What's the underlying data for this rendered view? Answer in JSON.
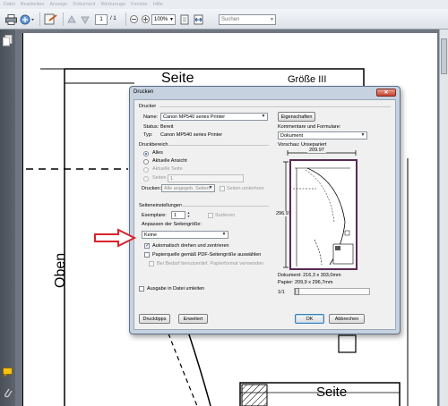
{
  "menubar": [
    "Datei",
    "Bearbeiten",
    "Anzeige",
    "Dokument",
    "Werkzeuge",
    "Fenster",
    "Hilfe"
  ],
  "toolbar": {
    "page_current": "1",
    "page_total": "/ 1",
    "zoom": "100%",
    "search_placeholder": "Suchen"
  },
  "document": {
    "label_seite_top": "Seite",
    "label_groesse": "Größe III",
    "label_oben": "Oben",
    "label_seite_bottom": "Seite"
  },
  "dialog": {
    "title": "Drucken",
    "printer_section": "Drucker",
    "name_label": "Name:",
    "printer_name": "Canon MP540 series Printer",
    "properties_button": "Eigenschaften",
    "status_label": "Status:",
    "status_value": "Bereit",
    "type_label": "Typ:",
    "type_value": "Canon MP540 series Printer",
    "comments_label": "Kommentare und Formulare:",
    "comments_value": "Dokument",
    "range_section": "Druckbereich",
    "range_all": "Alles",
    "range_current_view": "Aktuelle Ansicht",
    "range_current_page": "Aktuelle Seite",
    "range_pages": "Seiten",
    "range_pages_value": "1",
    "print_label": "Drucken:",
    "print_value": "Alle angegeb. Seiten",
    "reverse_pages": "Seiten umkehren",
    "settings_section": "Seiteneinstellungen",
    "copies_label": "Exemplare:",
    "copies_value": "1",
    "collate_label": "Sortieren",
    "scaling_label": "Anpassen der Seitengröße:",
    "scaling_value": "Keine",
    "auto_rotate_label": "Automatisch drehen und zentrieren",
    "paper_source_label": "Papierquelle gemäß PDF-Seitengröße auswählen",
    "custom_paper_label": "Bei Bedarf benutzerdef. Papierformat verwenden",
    "print_to_file_label": "Ausgabe in Datei umleiten",
    "preview_label": "Vorschau: Unsepariert",
    "preview_width": "209.97",
    "preview_height": "296.97",
    "document_size": "Dokument: 216,3 x 303,0mm",
    "paper_size": "Papier: 209,9 x 296,7mm",
    "page_indicator": "1/1",
    "tips_button": "Drucktipps",
    "advanced_button": "Erweitert",
    "ok_button": "OK",
    "cancel_button": "Abbrechen"
  },
  "colors": {
    "reader_background": "#6f7680",
    "dialog_frame": "#c6d2e0",
    "dialog_body": "#f0f0f0",
    "preview_page_frame": "#5a2a55",
    "arrow_red": "#d8232a"
  }
}
